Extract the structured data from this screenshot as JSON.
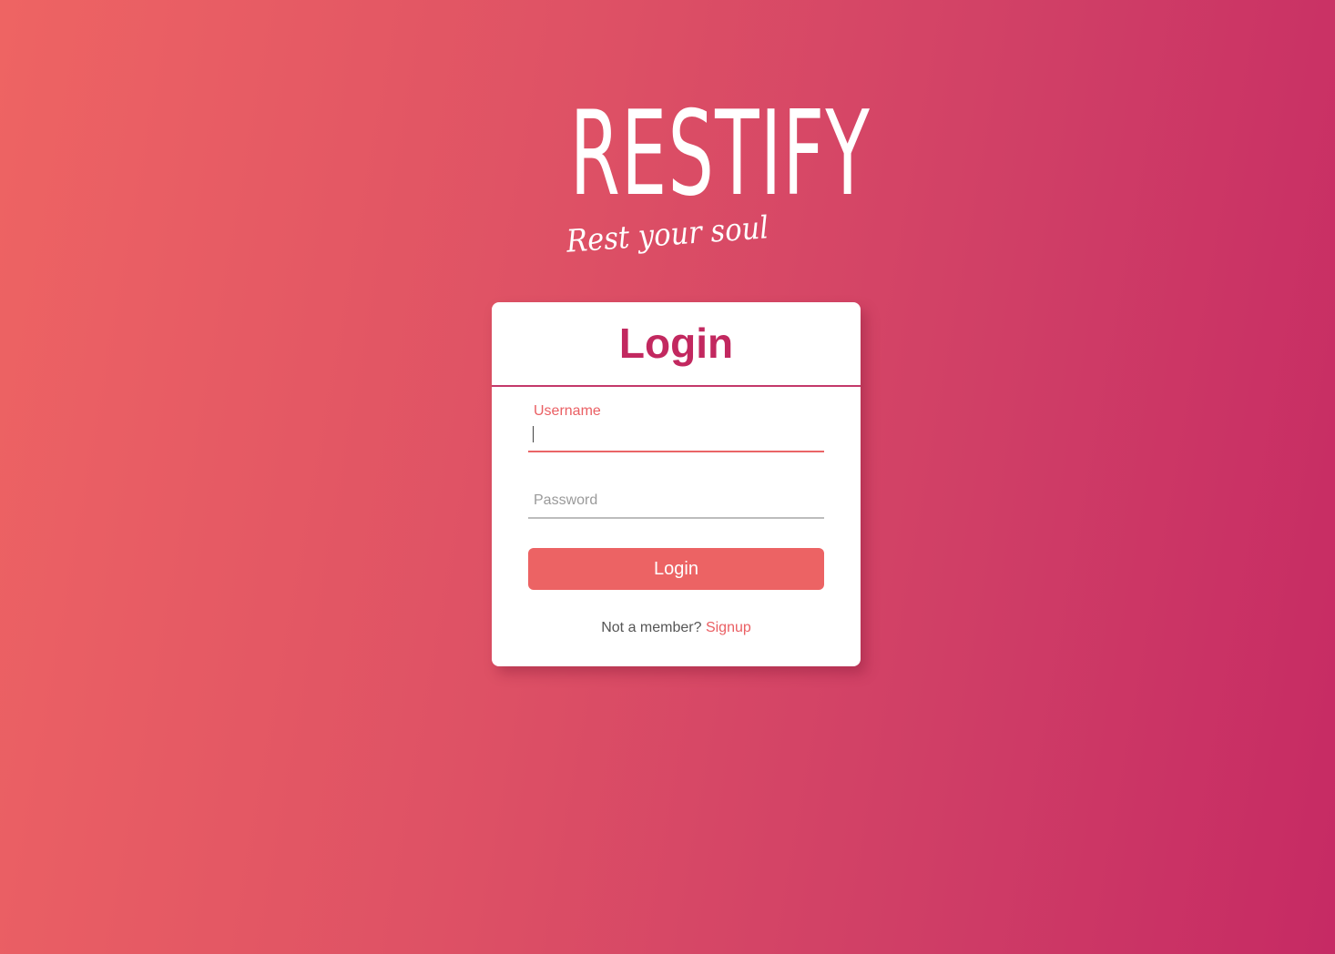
{
  "branding": {
    "logo_text": "RESTIFY",
    "tagline": "Rest your soul"
  },
  "login_card": {
    "title": "Login",
    "username": {
      "label": "Username",
      "value": ""
    },
    "password": {
      "placeholder": "Password",
      "value": ""
    },
    "submit_label": "Login",
    "signup_prompt": "Not a member?",
    "signup_link": "Signup"
  },
  "colors": {
    "background_start": "#ee6463",
    "background_end": "#c62a64",
    "title": "#c2285f",
    "accent": "#ec6364",
    "card": "#ffffff"
  }
}
